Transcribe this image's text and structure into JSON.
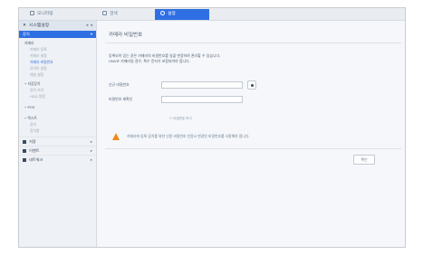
{
  "topbar": {
    "tabs": [
      {
        "label": "모니터링",
        "icon": "monitor-icon"
      },
      {
        "label": "검색",
        "icon": "search-icon"
      },
      {
        "label": "설정",
        "icon": "gear-icon",
        "active": true
      }
    ]
  },
  "sidebar": {
    "header": "시스템설정",
    "header_pin": "▸ ◂",
    "group_selected": "장치",
    "group_selected_arrow": "▾",
    "items": [
      {
        "label": "카메라",
        "kind": "head"
      },
      {
        "label": "카메라 등록",
        "kind": "sub"
      },
      {
        "label": "카메라 설정",
        "kind": "sub"
      },
      {
        "label": "카메라 비밀번호",
        "kind": "sub",
        "selected": true
      },
      {
        "label": "모아이 설정",
        "kind": "sub"
      },
      {
        "label": "채널 설정",
        "kind": "sub"
      },
      {
        "label": "• 저장장치",
        "kind": "head"
      },
      {
        "label": "장치 보기",
        "kind": "sub"
      },
      {
        "label": "HDD 알람",
        "kind": "sub"
      },
      {
        "label": "• POS",
        "kind": "head"
      },
      {
        "label": "• 텍스트",
        "kind": "head"
      },
      {
        "label": "장치",
        "kind": "sub"
      },
      {
        "label": "장치명",
        "kind": "sub"
      }
    ],
    "categories": [
      {
        "label": "저장",
        "icon": "storage-icon"
      },
      {
        "label": "이벤트",
        "icon": "event-icon"
      },
      {
        "label": "네트워크",
        "icon": "network-icon"
      }
    ],
    "cat_arrow": "▸"
  },
  "main": {
    "title": "카메라 비밀번호",
    "desc_line1": "등록되어 있는 같은 카메라의 비밀번호를 일괄 변경하여 관리할 수 있습니다.",
    "desc_line2": "ONVIF 카메라일 경우, 특수 문자가 포함되어야 합니다.",
    "new_password_label": "신규 비밀번호",
    "confirm_password_label": "비밀번호 재확인",
    "show_password_label": "☐ 비밀번호 보기",
    "warning": "카메라에 등록 장치를 위한 인증 비밀번호 인증시 변경된 비밀번호를 사용해야 합니다.",
    "confirm_button": "확인"
  }
}
